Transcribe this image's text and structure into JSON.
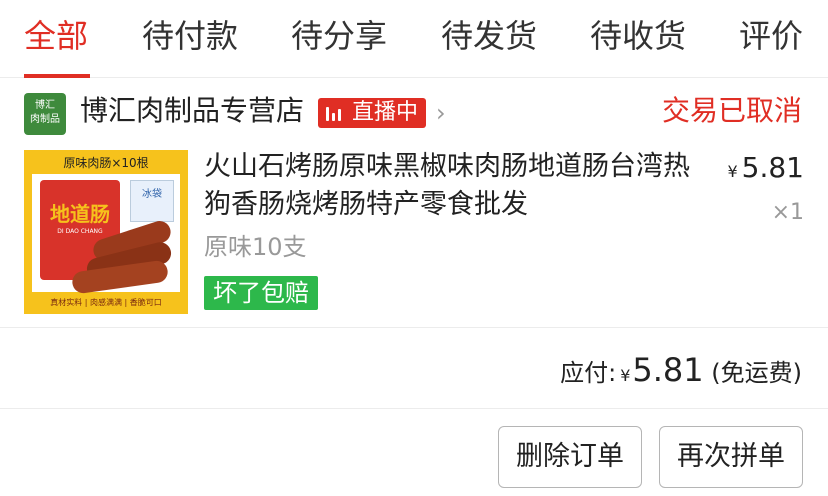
{
  "tabs": [
    {
      "label": "全部",
      "active": true
    },
    {
      "label": "待付款",
      "active": false
    },
    {
      "label": "待分享",
      "active": false
    },
    {
      "label": "待发货",
      "active": false
    },
    {
      "label": "待收货",
      "active": false
    },
    {
      "label": "评价",
      "active": false
    }
  ],
  "store": {
    "logo_line1": "博汇",
    "logo_line2": "肉制品",
    "name": "博汇肉制品专营店",
    "live_badge": "直播中",
    "chevron": "›",
    "order_status": "交易已取消"
  },
  "product": {
    "title": "火山石烤肠原味黑椒味肉肠地道肠台湾热狗香肠烧烤肠特产零食批发",
    "variant": "原味10支",
    "guarantee_badge": "坏了包赔",
    "currency": "¥",
    "unit_price": "5.81",
    "quantity": "×1",
    "thumb_banner": "原味肉肠×10根",
    "thumb_pack_title": "地道肠",
    "thumb_pack_sub": "DI DAO CHANG",
    "thumb_bag_label": "冰袋",
    "thumb_footer": "真材实料 | 肉感满满 | 香脆可口"
  },
  "summary": {
    "label": "应付:",
    "currency": "¥",
    "amount": "5.81",
    "note": "(免运费)"
  },
  "actions": {
    "delete_label": "删除订单",
    "rebuy_label": "再次拼单"
  },
  "colors": {
    "accent": "#e02e24",
    "guarantee": "#2db84b",
    "store_logo": "#3e8a3c",
    "muted": "#999999"
  }
}
